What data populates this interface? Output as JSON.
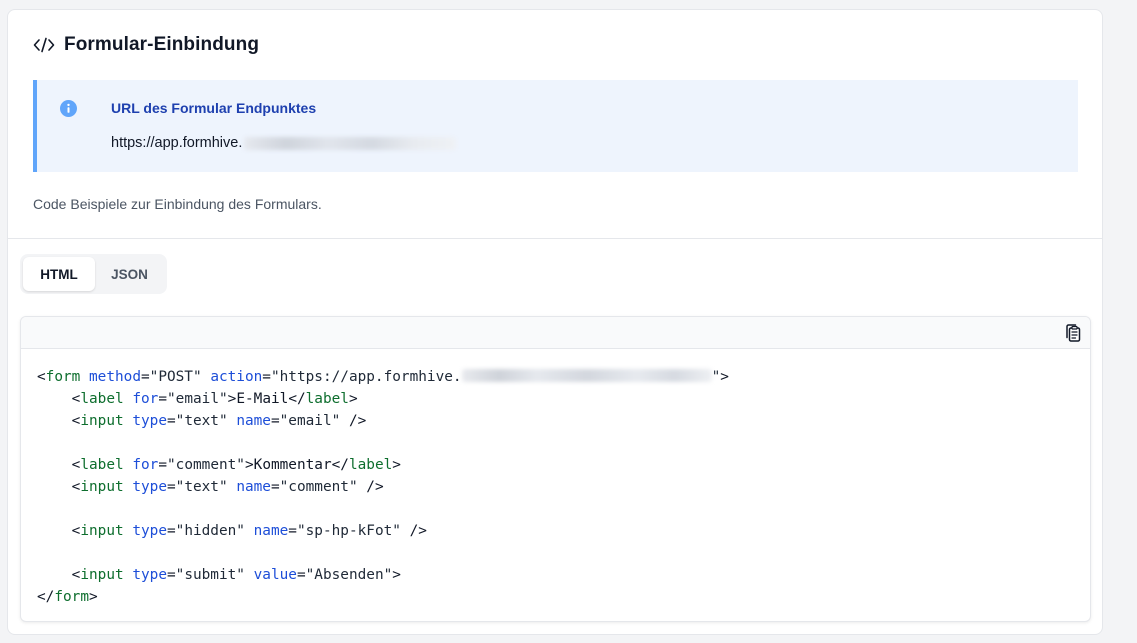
{
  "header": {
    "icon": "code-icon",
    "title": "Formular-Einbindung"
  },
  "info": {
    "icon": "info-icon",
    "title": "URL des Formular Endpunktes",
    "url_prefix": "https://app.formhive."
  },
  "description": "Code Beispiele zur Einbindung des Formulars.",
  "tabs": [
    {
      "label": "HTML",
      "active": true
    },
    {
      "label": "JSON",
      "active": false
    }
  ],
  "code_panel": {
    "copy_icon": "clipboard-copy-icon",
    "lines": {
      "form_open": {
        "tag": "form",
        "attr1": "method",
        "val1": "\"POST\"",
        "attr2": "action",
        "val2_prefix": "\"https://app.formhive.",
        "val2_suffix": "\""
      },
      "label_email": {
        "tag": "label",
        "attr": "for",
        "val": "\"email\"",
        "text": "E-Mail"
      },
      "input_email": {
        "tag": "input",
        "attr1": "type",
        "val1": "\"text\"",
        "attr2": "name",
        "val2": "\"email\""
      },
      "label_comment": {
        "tag": "label",
        "attr": "for",
        "val": "\"comment\"",
        "text": "Kommentar"
      },
      "input_comment": {
        "tag": "input",
        "attr1": "type",
        "val1": "\"text\"",
        "attr2": "name",
        "val2": "\"comment\""
      },
      "input_hidden": {
        "tag": "input",
        "attr1": "type",
        "val1": "\"hidden\"",
        "attr2": "name",
        "val2": "\"sp-hp-kFot\""
      },
      "input_submit": {
        "tag": "input",
        "attr1": "type",
        "val1": "\"submit\"",
        "attr2": "value",
        "val2": "\"Absenden\""
      }
    }
  },
  "colors": {
    "info_bg": "#eef4fd",
    "info_border": "#60a5fa",
    "info_title": "#1e40af",
    "code_tag": "#0e6e2e",
    "code_attr": "#1d4ed8"
  }
}
